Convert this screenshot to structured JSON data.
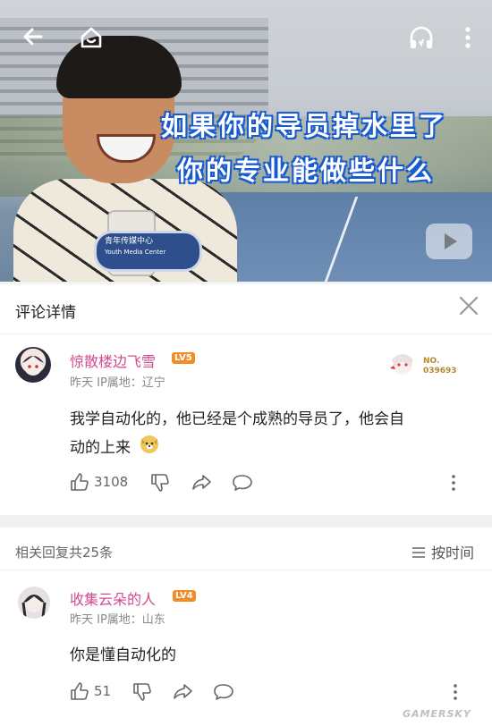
{
  "video": {
    "overlay_line1": "如果你的导员掉水里了",
    "overlay_line2": "你的专业能做些什么",
    "mic_text_line1": "青年传媒中心",
    "mic_text_line2": "Youth Media Center"
  },
  "topbar": {
    "back_icon": "arrow-left-icon",
    "home_icon": "home-icon",
    "audio_icon": "headphones-icon",
    "more_icon": "more-vertical-icon"
  },
  "panel": {
    "title": "评论详情",
    "close_icon": "close-icon"
  },
  "main_comment": {
    "username": "惊散楼边飞雪",
    "level": "LV5",
    "meta": "昨天 IP属地：辽宁",
    "text_line1": "我学自动化的，他已经是个成熟的导员了，他会自",
    "text_line2": "动的上来",
    "emoji_icon": "dog-emoji-icon",
    "likes": "3108",
    "badge_line1": "NO.",
    "badge_line2": "039693"
  },
  "replies": {
    "count_label": "相关回复共25条",
    "sort_label": "按时间"
  },
  "reply": {
    "username": "收集云朵的人",
    "level": "LV4",
    "meta": "昨天 IP属地：山东",
    "text": "你是懂自动化的",
    "likes": "51"
  },
  "watermark": "GAMERSKY",
  "colors": {
    "username": "#d24b8e",
    "level_badge": "#f28c28",
    "overlay_stroke": "#1a5bd0"
  }
}
